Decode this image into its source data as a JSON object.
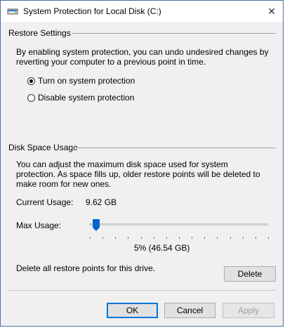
{
  "window": {
    "title": "System Protection for Local Disk (C:)",
    "icon": "drive-icon",
    "close_glyph": "✕"
  },
  "restore": {
    "group_label": "Restore Settings",
    "description": "By enabling system protection, you can undo undesired changes by reverting your computer to a previous point in time.",
    "options": [
      {
        "label": "Turn on system protection",
        "selected": true
      },
      {
        "label": "Disable system protection",
        "selected": false
      }
    ]
  },
  "disk": {
    "group_label": "Disk Space Usage",
    "description": "You can adjust the maximum disk space used for system protection. As space fills up, older restore points will be deleted to make room for new ones.",
    "current_usage_label": "Current Usage:",
    "current_usage_value": "9.62 GB",
    "max_usage_label": "Max Usage:",
    "max_usage_value": "5% (46.54 GB)",
    "max_usage_percent": 5,
    "delete_text": "Delete all restore points for this drive.",
    "delete_button": "Delete"
  },
  "footer": {
    "ok": "OK",
    "cancel": "Cancel",
    "apply": "Apply"
  },
  "colors": {
    "accent": "#0078d7",
    "slider_thumb": "#0066cc"
  }
}
